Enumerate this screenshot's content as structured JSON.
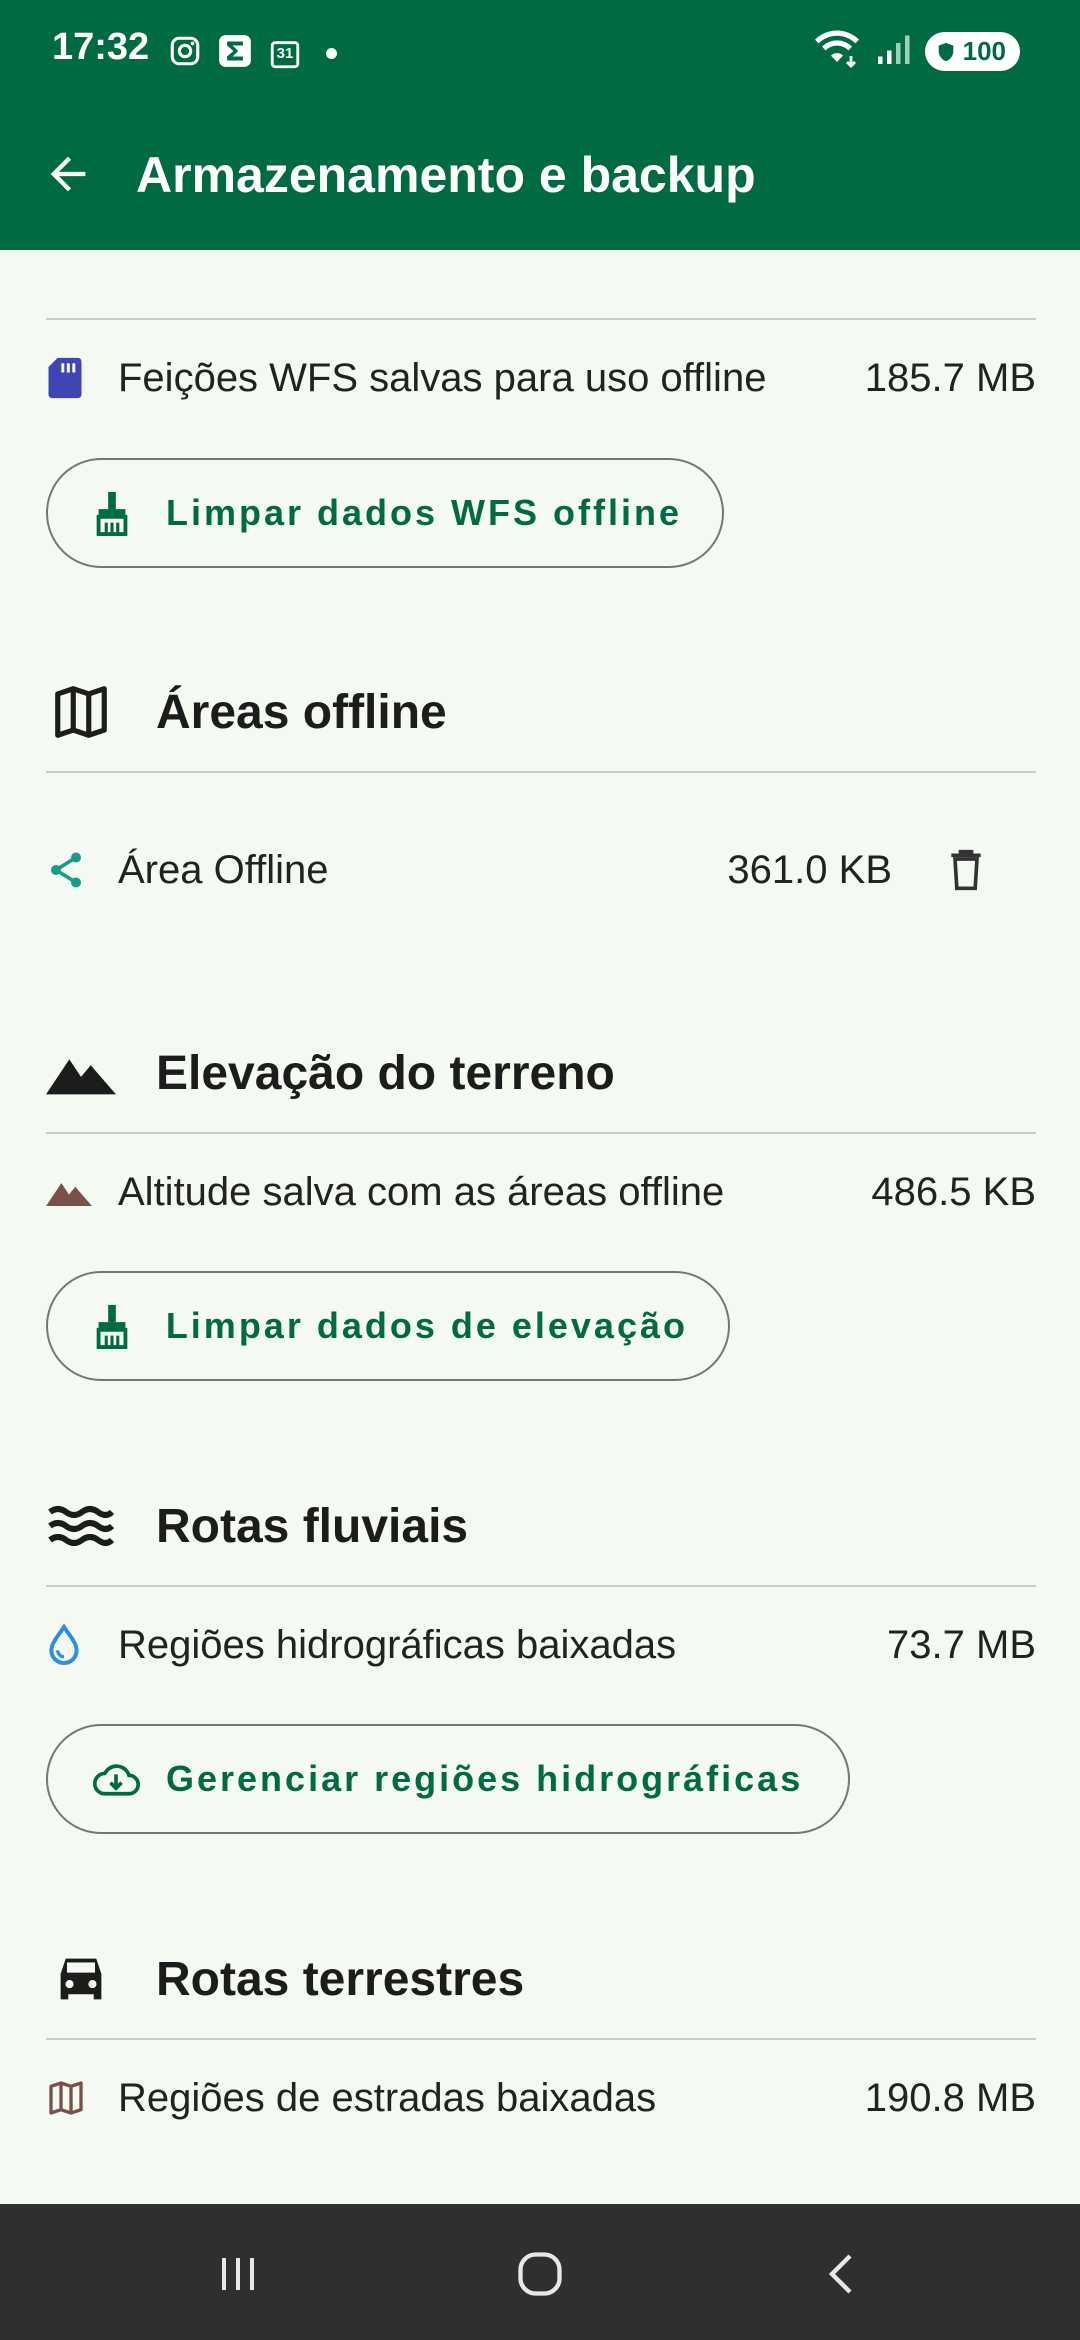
{
  "status_bar": {
    "time": "17:32",
    "calendar_day": "31",
    "battery": "100"
  },
  "toolbar": {
    "title": "Armazenamento e backup"
  },
  "wfs": {
    "row_label": "Feições WFS salvas para uso offline",
    "row_value": "185.7 MB",
    "button_label": "Limpar dados WFS offline"
  },
  "offline_areas": {
    "title": "Áreas offline",
    "items": [
      {
        "label": "Área Offline",
        "value": "361.0 KB"
      }
    ]
  },
  "elevation": {
    "title": "Elevação do terreno",
    "row_label": "Altitude salva com as áreas offline",
    "row_value": "486.5 KB",
    "button_label": "Limpar dados de elevação"
  },
  "river_routes": {
    "title": "Rotas fluviais",
    "row_label": "Regiões hidrográficas baixadas",
    "row_value": "73.7 MB",
    "button_label": "Gerenciar regiões hidrográficas"
  },
  "land_routes": {
    "title": "Rotas terrestres",
    "row_label": "Regiões de estradas baixadas",
    "row_value": "190.8 MB"
  },
  "colors": {
    "primary": "#006b43",
    "background": "#f4f9f2",
    "sd_card_icon": "#3f45b5",
    "share_icon": "#1a9a8c",
    "terrain_icon": "#7a5148",
    "water_icon": "#2d8fe0"
  },
  "icons": {
    "back": "arrow-left-icon",
    "sd_card": "sd-card-icon",
    "broom": "broom-icon",
    "map": "map-icon",
    "share": "share-nodes-icon",
    "trash": "trash-icon",
    "mountain": "mountain-icon",
    "waves": "waves-icon",
    "water_drop": "water-drop-icon",
    "cloud_download": "cloud-download-icon",
    "car": "car-icon"
  }
}
